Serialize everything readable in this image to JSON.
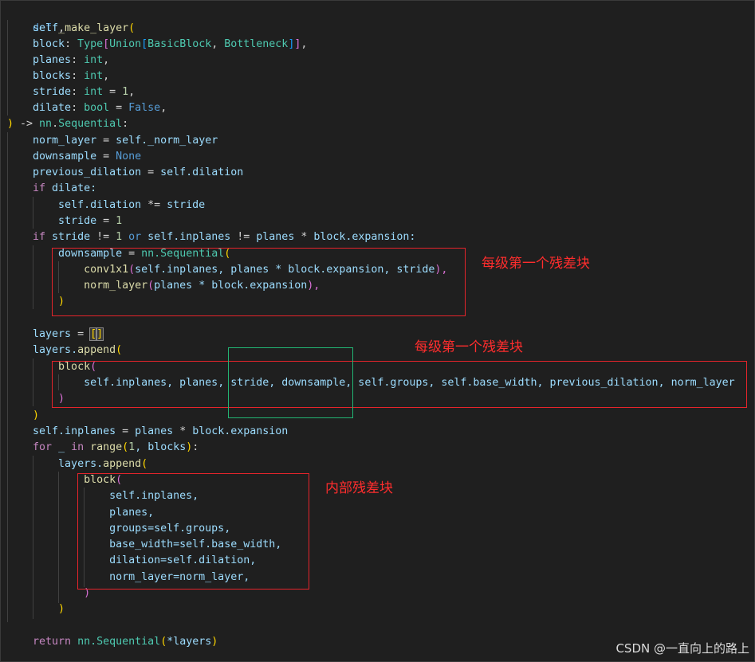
{
  "code": {
    "l1": {
      "def": "def",
      "fn": "_make_layer",
      "open": "("
    },
    "l2": {
      "self": "self",
      "comma": ","
    },
    "l3": {
      "name": "block",
      "colon": ": ",
      "type1": "Type",
      "lb1": "[",
      "type2": "Union",
      "lb2": "[",
      "t1": "BasicBlock",
      "sep": ", ",
      "t2": "Bottleneck",
      "rb2": "]",
      "rb1": "]",
      "comma": ","
    },
    "l4": {
      "name": "planes",
      "colon": ": ",
      "type": "int",
      "comma": ","
    },
    "l5": {
      "name": "blocks",
      "colon": ": ",
      "type": "int",
      "comma": ","
    },
    "l6": {
      "name": "stride",
      "colon": ": ",
      "type": "int",
      "eq": " = ",
      "val": "1",
      "comma": ","
    },
    "l7": {
      "name": "dilate",
      "colon": ": ",
      "type": "bool",
      "eq": " = ",
      "val": "False",
      "comma": ","
    },
    "l8": {
      "close": ")",
      "arrow": " -> ",
      "mod": "nn",
      "dot": ".",
      "cls": "Sequential",
      "colon": ":"
    },
    "l9": {
      "lhs": "norm_layer",
      "eq": " = ",
      "rhs": "self._norm_layer"
    },
    "l10": {
      "lhs": "downsample",
      "eq": " = ",
      "rhs": "None"
    },
    "l11": {
      "lhs": "previous_dilation",
      "eq": " = ",
      "rhs": "self.dilation"
    },
    "l12": {
      "kw": "if",
      "rest": " dilate:"
    },
    "l13": {
      "lhs": "self.dilation",
      "op": " *= ",
      "rhs": "stride"
    },
    "l14": {
      "lhs": "stride",
      "eq": " = ",
      "val": "1"
    },
    "l15": {
      "kw": "if",
      "a": " stride ",
      "op": "!=",
      "sp": " ",
      "one": "1",
      "sp2": " ",
      "or": "or",
      "b": " self.inplanes ",
      "op2": "!=",
      "c": " planes ",
      "mul": "*",
      "d": " block.expansion:"
    },
    "l16": {
      "lhs": "downsample",
      "eq": " = ",
      "mod": "nn.",
      "cls": "Sequential",
      "open": "("
    },
    "l17": {
      "fn": "conv1x1",
      "open": "(",
      "args": "self.inplanes, planes * block.expansion, stride",
      "close": "),"
    },
    "l18": {
      "fn": "norm_layer",
      "open": "(",
      "args": "planes * block.expansion",
      "close": "),"
    },
    "l19": {
      "close": ")"
    },
    "l21": {
      "lhs": "layers",
      "eq": " = ",
      "lb": "[",
      "rb": "]"
    },
    "l22": {
      "obj": "layers.",
      "fn": "append",
      "open": "("
    },
    "l23": {
      "fn": "block",
      "open": "("
    },
    "l24": {
      "args": "self.inplanes, planes, stride, downsample, self.groups, self.base_width, previous_dilation, norm_layer"
    },
    "l25": {
      "close": ")"
    },
    "l26": {
      "close": ")"
    },
    "l27": {
      "lhs": "self.inplanes",
      "eq": " = ",
      "a": "planes",
      "mul": " * ",
      "b": "block.expansion"
    },
    "l28": {
      "kw": "for",
      "a": " _ ",
      "in": "in",
      "sp": " ",
      "fn": "range",
      "open": "(",
      "one": "1",
      "rest": ", blocks",
      "close": ")",
      "colon": ":"
    },
    "l29": {
      "obj": "layers.",
      "fn": "append",
      "open": "("
    },
    "l30": {
      "fn": "block",
      "open": "("
    },
    "l31": {
      "arg": "self.inplanes,"
    },
    "l32": {
      "arg": "planes,"
    },
    "l33": {
      "arg": "groups=self.groups,"
    },
    "l34": {
      "arg": "base_width=self.base_width,"
    },
    "l35": {
      "arg": "dilation=self.dilation,"
    },
    "l36": {
      "arg": "norm_layer=norm_layer,"
    },
    "l37": {
      "close": ")"
    },
    "l38": {
      "close": ")"
    },
    "l40": {
      "kw": "return",
      "sp": " ",
      "mod": "nn.",
      "cls": "Sequential",
      "open": "(",
      "arg": "*layers",
      "close": ")"
    }
  },
  "annotations": {
    "first_residual_1": "每级第一个残差块",
    "first_residual_2": "每级第一个残差块",
    "inner_residual": "内部残差块"
  },
  "colors": {
    "highlight_box": "#e5242b",
    "param_box": "#22b573",
    "annotation_text": "#ff2d2d"
  },
  "watermark": "CSDN @一直向上的路上"
}
